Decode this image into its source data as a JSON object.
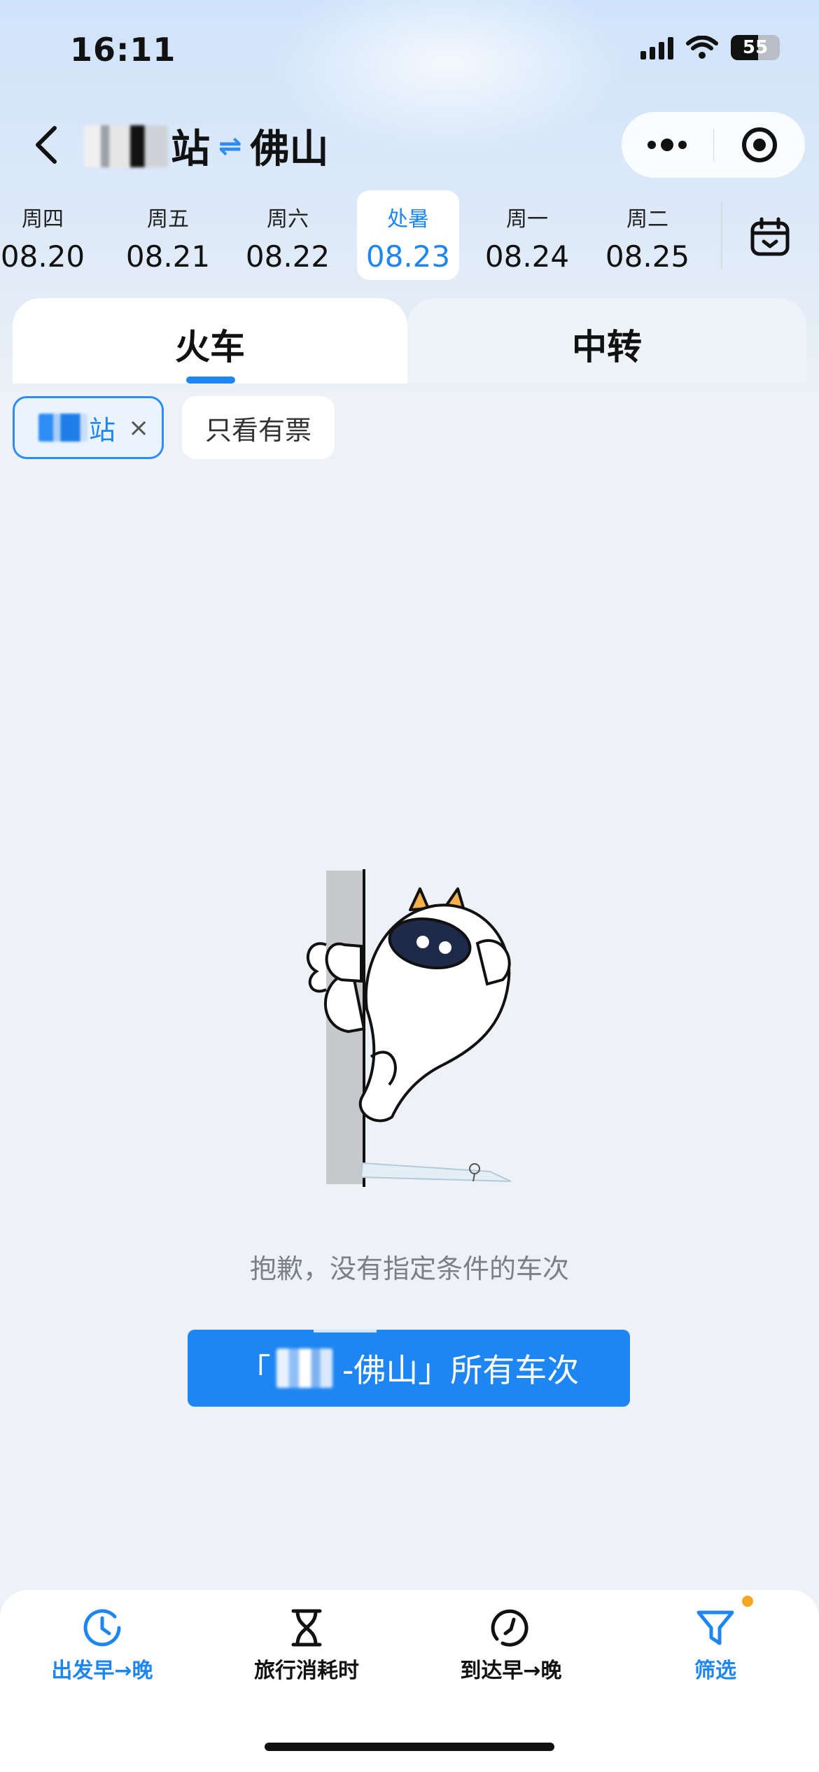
{
  "status_bar": {
    "time": "16:11",
    "battery": "55"
  },
  "header": {
    "origin_suffix": "站",
    "destination": "佛山",
    "swap_symbol": "⇌"
  },
  "dates": [
    {
      "weekday": "周四",
      "date": "08.20",
      "active": false
    },
    {
      "weekday": "周五",
      "date": "08.21",
      "active": false
    },
    {
      "weekday": "周六",
      "date": "08.22",
      "active": false
    },
    {
      "weekday": "处暑",
      "date": "08.23",
      "active": true
    },
    {
      "weekday": "周一",
      "date": "08.24",
      "active": false
    },
    {
      "weekday": "周二",
      "date": "08.25",
      "active": false
    }
  ],
  "tabs": {
    "train": "火车",
    "transfer": "中转"
  },
  "filters": {
    "station_chip_suffix": "站",
    "close_symbol": "×",
    "only_available": "只看有票"
  },
  "empty_state": {
    "message": "抱歉，没有指定条件的车次",
    "button_prefix": "「",
    "button_suffix": "-佛山」所有车次"
  },
  "bottom_bar": {
    "depart_sort": "出发早→晚",
    "duration_sort": "旅行消耗时",
    "arrive_sort": "到达早→晚",
    "filter": "筛选"
  },
  "colors": {
    "accent": "#1e86f2",
    "badge": "#f5a623"
  },
  "icons": [
    "back-icon",
    "more-icon",
    "target-icon",
    "calendar-icon",
    "clock-icon",
    "hourglass-icon",
    "arrive-clock-icon",
    "funnel-icon"
  ]
}
